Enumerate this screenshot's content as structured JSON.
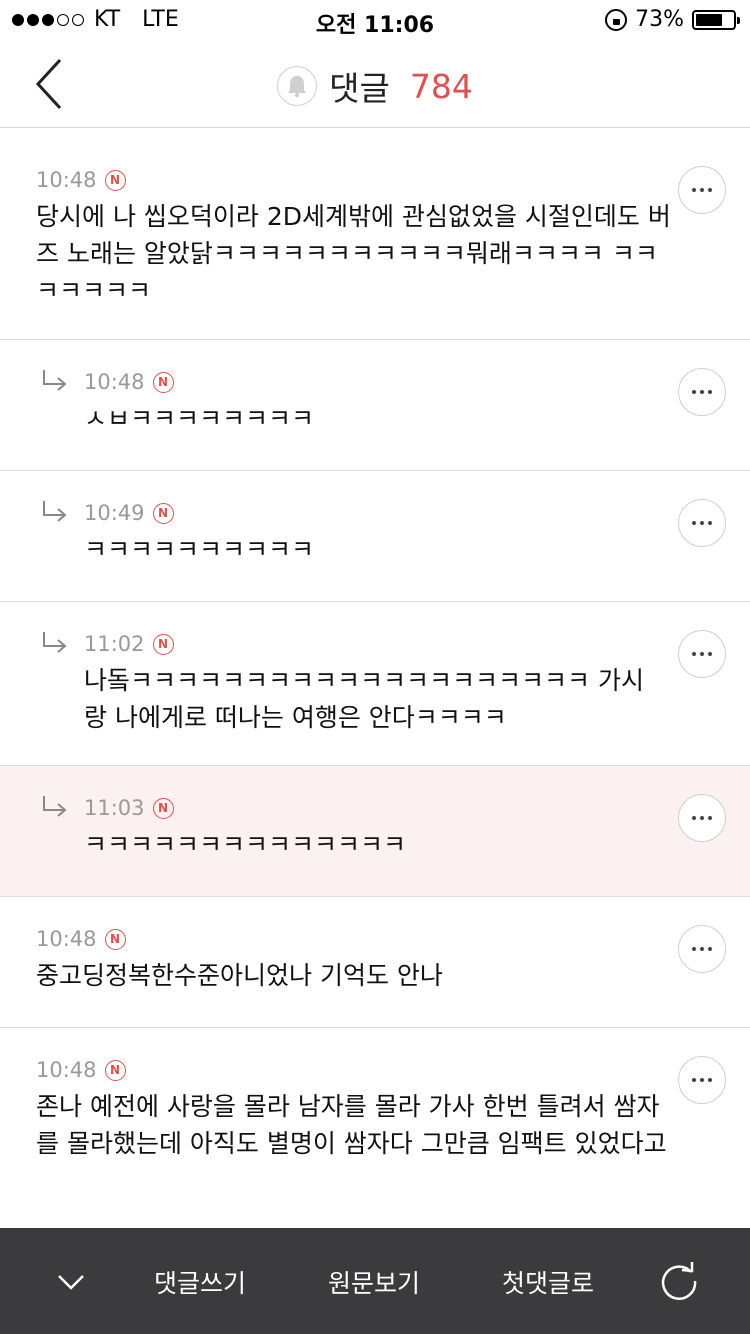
{
  "status": {
    "carrier": "KT",
    "network": "LTE",
    "time": "오전 11:06",
    "battery": "73%",
    "battery_level": 0.73
  },
  "header": {
    "title": "댓글",
    "count": "784"
  },
  "comments": [
    {
      "time": "10:48",
      "badge": "N",
      "text": "당시에 나 씹오덕이라 2D세계밖에 관심없었을 시절인데도 버즈 노래는 알았닭ㅋㅋㅋㅋㅋㅋㅋㅋㅋㅋㅋ뭐래ㅋㅋㅋㅋ ㅋㅋㅋㅋㅋㅋㅋ"
    },
    {
      "time": "10:48",
      "badge": "N",
      "text": "ㅅㅂㅋㅋㅋㅋㅋㅋㅋㅋ"
    },
    {
      "time": "10:49",
      "badge": "N",
      "text": "ㅋㅋㅋㅋㅋㅋㅋㅋㅋㅋ"
    },
    {
      "time": "11:02",
      "badge": "N",
      "text": "나돜ㅋㅋㅋㅋㅋㅋㅋㅋㅋㅋㅋㅋㅋㅋㅋㅋㅋㅋㅋㅋ 가시랑 나에게로 떠나는 여행은 안다ㅋㅋㅋㅋ"
    },
    {
      "time": "11:03",
      "badge": "N",
      "text": "ㅋㅋㅋㅋㅋㅋㅋㅋㅋㅋㅋㅋㅋㅋ"
    },
    {
      "time": "10:48",
      "badge": "N",
      "text": "중고딩정복한수준아니었나 기억도 안나"
    },
    {
      "time": "10:48",
      "badge": "N",
      "text": "존나 예전에 사랑을 몰라 남자를 몰라 가사 한번 틀려서 쌈자를 몰라했는데 아직도 별명이 쌈자다 그만큼 임팩트 있었다고"
    }
  ],
  "bottom": {
    "write": "댓글쓰기",
    "original": "원문보기",
    "first": "첫댓글로"
  },
  "colors": {
    "accent": "#d9534f",
    "highlight_bg": "#fcf1f1",
    "bottom_bar": "#3b3b3e"
  }
}
